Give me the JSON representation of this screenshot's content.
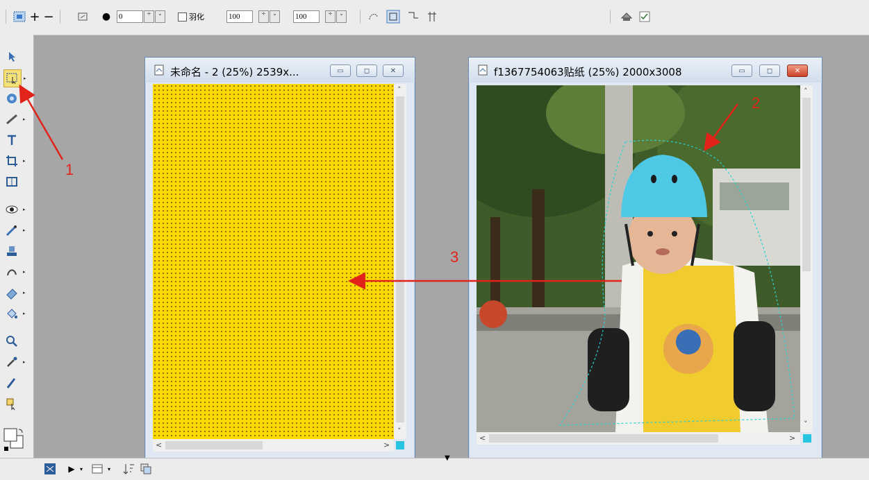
{
  "toolbar": {
    "spin1_value": "0",
    "antialias_label": "羽化",
    "width_value": "100",
    "height_value": "100"
  },
  "doc_left": {
    "title": "未命名 - 2 (25%) 2539x..."
  },
  "doc_right": {
    "title": "f1367754063贴纸 (25%) 2000x3008"
  },
  "annotations": {
    "label_1": "1",
    "label_2": "2",
    "label_3": "3"
  },
  "colors": {
    "canvas_fill": "#ffd800",
    "annotation_red": "#e2231a",
    "accent_cyan": "#27c5e0"
  }
}
